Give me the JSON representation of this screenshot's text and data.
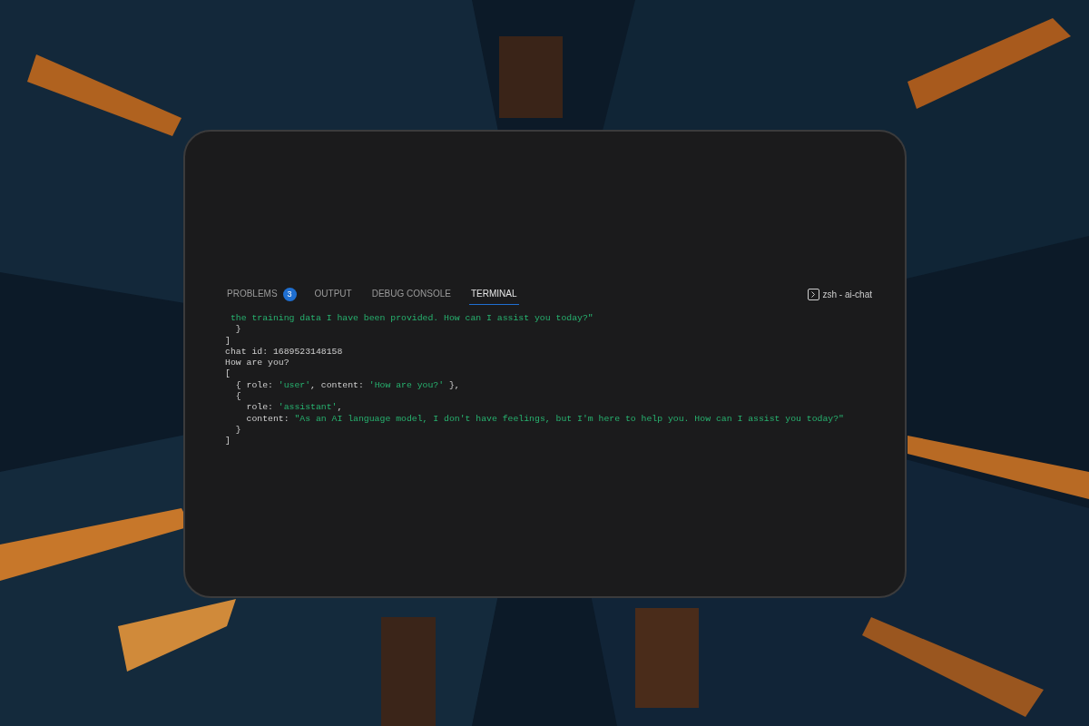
{
  "panel": {
    "tabs": [
      {
        "label": "PROBLEMS",
        "badge": "3",
        "selected": false
      },
      {
        "label": "OUTPUT",
        "selected": false
      },
      {
        "label": "DEBUG CONSOLE",
        "selected": false
      },
      {
        "label": "TERMINAL",
        "selected": true
      }
    ],
    "terminal_name": "zsh - ai-chat",
    "lines": [
      [
        {
          "kind": "string",
          "text": " the training data I have been provided. How can I assist you today?\""
        }
      ],
      [
        {
          "kind": "plain",
          "text": "  }"
        }
      ],
      [
        {
          "kind": "plain",
          "text": "]"
        }
      ],
      [
        {
          "kind": "plain",
          "text": "chat id: 1689523148158"
        }
      ],
      [
        {
          "kind": "plain",
          "text": "How are you?"
        }
      ],
      [
        {
          "kind": "plain",
          "text": "["
        }
      ],
      [
        {
          "kind": "plain",
          "text": "  { role: "
        },
        {
          "kind": "string",
          "text": "'user'"
        },
        {
          "kind": "plain",
          "text": ", content: "
        },
        {
          "kind": "string",
          "text": "'How are you?'"
        },
        {
          "kind": "plain",
          "text": " },"
        }
      ],
      [
        {
          "kind": "plain",
          "text": "  {"
        }
      ],
      [
        {
          "kind": "plain",
          "text": "    role: "
        },
        {
          "kind": "string",
          "text": "'assistant'"
        },
        {
          "kind": "plain",
          "text": ","
        }
      ],
      [
        {
          "kind": "plain",
          "text": "    content: "
        },
        {
          "kind": "string",
          "text": "\"As an AI language model, I don't have feelings, but I'm here to help you. How can I assist you today?\""
        }
      ],
      [
        {
          "kind": "plain",
          "text": "  }"
        }
      ],
      [
        {
          "kind": "plain",
          "text": "]"
        }
      ]
    ]
  }
}
